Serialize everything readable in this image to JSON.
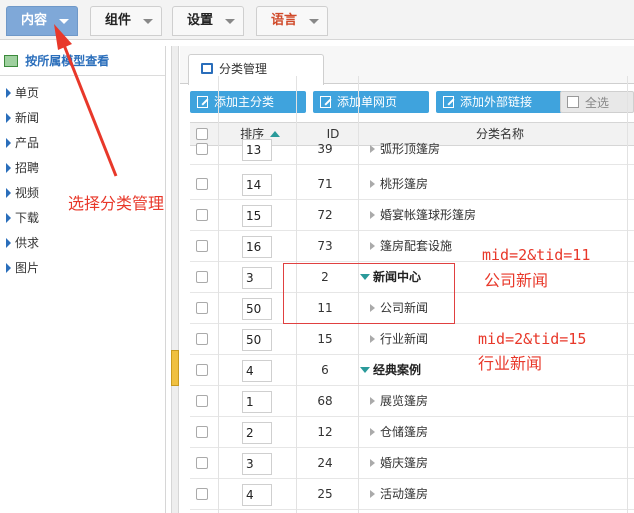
{
  "nav": {
    "tabs": [
      {
        "label": "内容"
      },
      {
        "label": "组件"
      },
      {
        "label": "设置"
      },
      {
        "label": "语言"
      }
    ]
  },
  "sidebar": {
    "title": "按所属模型查看",
    "items": [
      {
        "label": "单页"
      },
      {
        "label": "新闻"
      },
      {
        "label": "产品"
      },
      {
        "label": "招聘"
      },
      {
        "label": "视频"
      },
      {
        "label": "下载"
      },
      {
        "label": "供求"
      },
      {
        "label": "图片"
      }
    ]
  },
  "panel": {
    "tab_label": "分类管理",
    "buttons": {
      "add_main": "添加主分类",
      "add_page": "添加单网页",
      "add_link": "添加外部链接",
      "select_all": "全选"
    },
    "columns": {
      "order": "排序",
      "id": "ID",
      "name": "分类名称"
    },
    "rows": [
      {
        "order": "13",
        "id": "39",
        "name": "弧形顶篷房",
        "top": false
      },
      {
        "order": "14",
        "id": "71",
        "name": "桃形篷房",
        "top": false
      },
      {
        "order": "15",
        "id": "72",
        "name": "婚宴帐篷球形篷房",
        "top": false
      },
      {
        "order": "16",
        "id": "73",
        "name": "篷房配套设施",
        "top": false
      },
      {
        "order": "3",
        "id": "2",
        "name": "新闻中心",
        "top": true
      },
      {
        "order": "50",
        "id": "11",
        "name": "公司新闻",
        "top": false
      },
      {
        "order": "50",
        "id": "15",
        "name": "行业新闻",
        "top": false
      },
      {
        "order": "4",
        "id": "6",
        "name": "经典案例",
        "top": true
      },
      {
        "order": "1",
        "id": "68",
        "name": "展览篷房",
        "top": false
      },
      {
        "order": "2",
        "id": "12",
        "name": "仓储篷房",
        "top": false
      },
      {
        "order": "3",
        "id": "24",
        "name": "婚庆篷房",
        "top": false
      },
      {
        "order": "4",
        "id": "25",
        "name": "活动篷房",
        "top": false
      }
    ]
  },
  "annotations": {
    "select_hint": "选择分类管理",
    "note1_code": "mid=2&tid=11",
    "note1_text": "公司新闻",
    "note2_code": "mid=2&tid=15",
    "note2_text": "行业新闻",
    "color": "#e8382a"
  }
}
